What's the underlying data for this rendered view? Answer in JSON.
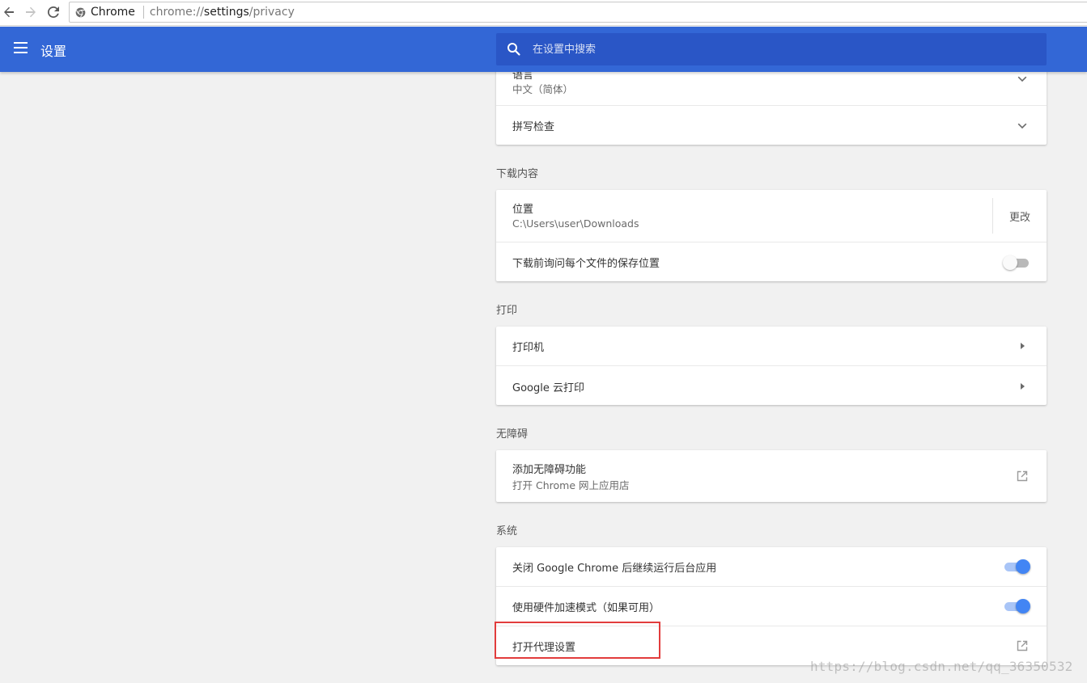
{
  "browser": {
    "site_name": "Chrome",
    "url_scheme": "chrome://",
    "url_host": "settings",
    "url_path": "/privacy"
  },
  "header": {
    "title": "设置",
    "search_placeholder": "在设置中搜索"
  },
  "language_card": {
    "language_row": {
      "title": "语言",
      "value": "中文（简体）"
    },
    "spellcheck_row": {
      "title": "拼写检查"
    }
  },
  "downloads": {
    "section_title": "下载内容",
    "location_row": {
      "title": "位置",
      "path": "C:\\Users\\user\\Downloads",
      "change_label": "更改"
    },
    "ask_row": {
      "title": "下载前询问每个文件的保存位置",
      "enabled": false
    }
  },
  "printing": {
    "section_title": "打印",
    "printers_row": {
      "title": "打印机"
    },
    "cloud_print_row": {
      "title": "Google 云打印"
    }
  },
  "accessibility": {
    "section_title": "无障碍",
    "add_features_row": {
      "title": "添加无障碍功能",
      "subtitle": "打开 Chrome 网上应用店"
    }
  },
  "system": {
    "section_title": "系统",
    "background_apps_row": {
      "title": "关闭 Google Chrome 后继续运行后台应用",
      "enabled": true
    },
    "hardware_accel_row": {
      "title": "使用硬件加速模式（如果可用）",
      "enabled": true
    },
    "proxy_row": {
      "title": "打开代理设置"
    }
  },
  "watermark": "https://blog.csdn.net/qq_36350532",
  "colors": {
    "header_blue": "#3367d6",
    "search_blue": "#2a56c6",
    "toggle_on": "#4285f4",
    "highlight_red": "#e23c3c",
    "page_bg": "#f1f1f1"
  }
}
